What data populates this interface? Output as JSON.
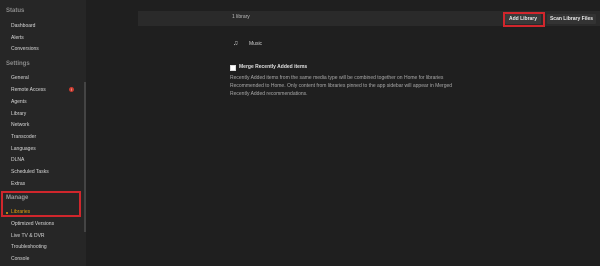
{
  "sidebar": {
    "sections": [
      {
        "title": "Status",
        "items": [
          {
            "label": "Dashboard"
          },
          {
            "label": "Alerts"
          },
          {
            "label": "Conversions"
          }
        ]
      },
      {
        "title": "Settings",
        "items": [
          {
            "label": "General"
          },
          {
            "label": "Remote Access",
            "badge": "!"
          },
          {
            "label": "Agents"
          },
          {
            "label": "Library"
          },
          {
            "label": "Network"
          },
          {
            "label": "Transcoder"
          },
          {
            "label": "Languages"
          },
          {
            "label": "DLNA"
          },
          {
            "label": "Scheduled Tasks"
          },
          {
            "label": "Extras"
          }
        ]
      },
      {
        "title": "Manage",
        "items": [
          {
            "label": "Libraries",
            "active": true
          },
          {
            "label": "Optimized Versions"
          },
          {
            "label": "Live TV & DVR"
          },
          {
            "label": "Troubleshooting"
          },
          {
            "label": "Console"
          }
        ]
      }
    ]
  },
  "toolbar": {
    "library_count": "1 library",
    "add_library_label": "Add Library",
    "scan_library_label": "Scan Library Files"
  },
  "libraries": [
    {
      "name": "Music",
      "icon": "music-note-icon"
    }
  ],
  "merge": {
    "checked": false,
    "label": "Merge Recently Added items",
    "description": "Recently Added items from the same media type will be combined together on Home for libraries Recommended to Home. Only content from libraries pinned to the app sidebar will appear in Merged Recently Added recommendations."
  },
  "colors": {
    "accent": "#e5a00d",
    "highlight_box": "#d0262c"
  }
}
